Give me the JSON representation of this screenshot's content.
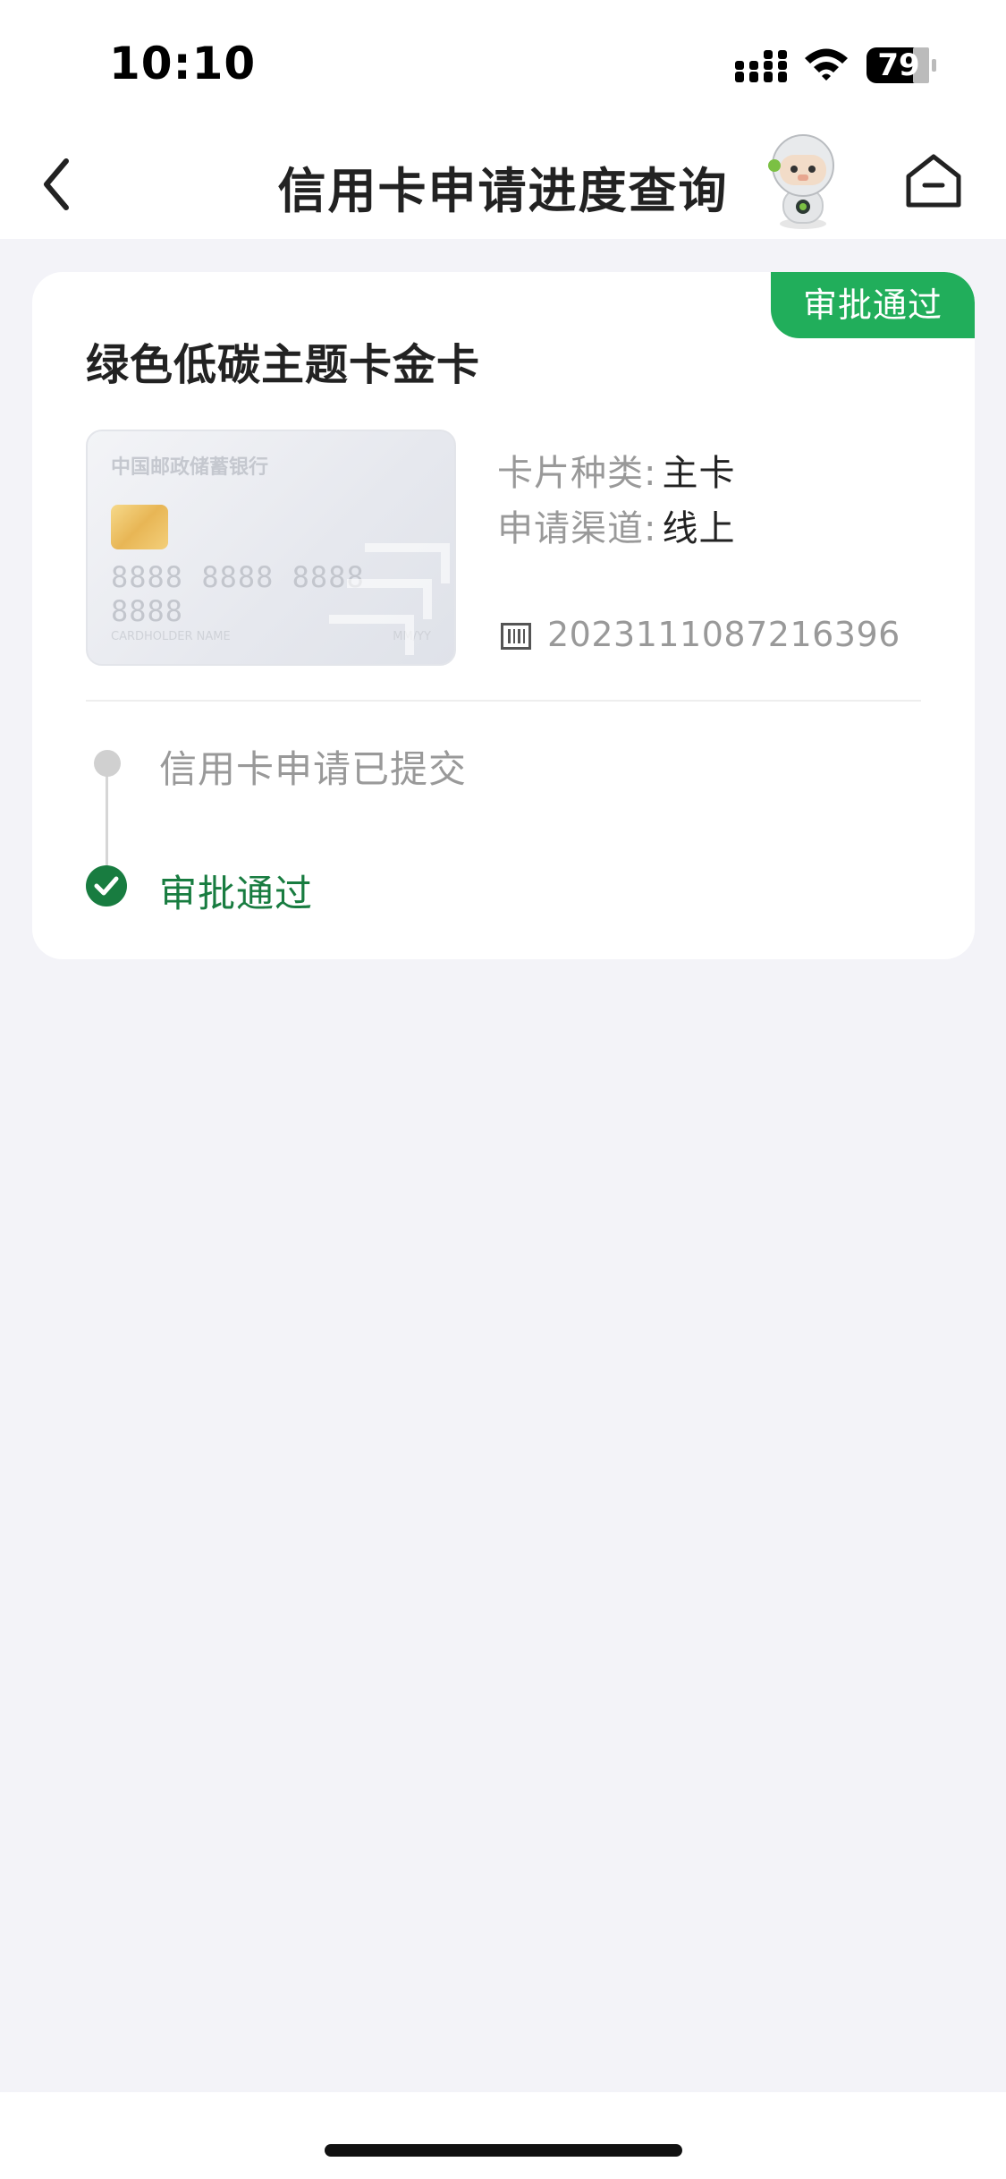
{
  "status_bar": {
    "time": "10:10",
    "battery": "79",
    "icons": [
      "signal-icon",
      "wifi-icon",
      "battery-icon"
    ]
  },
  "nav": {
    "title": "信用卡申请进度查询",
    "icons": [
      "back-icon",
      "robot-assistant-icon",
      "home-icon"
    ]
  },
  "application": {
    "status_badge": "审批通过",
    "card_name": "绿色低碳主题卡金卡",
    "card_image": {
      "bank_name": "中国邮政储蓄银行",
      "number": "8888 8888 8888 8888",
      "holder": "CARDHOLDER NAME",
      "expiry": "MM/YY"
    },
    "card_type_label": "卡片种类:",
    "card_type_value": "主卡",
    "channel_label": "申请渠道:",
    "channel_value": "线上",
    "application_number": "2023111087216396"
  },
  "timeline": [
    {
      "label": "信用卡申请已提交",
      "state": "done-grey"
    },
    {
      "label": "审批通过",
      "state": "current-green"
    }
  ],
  "colors": {
    "accent_green": "#21ae5b",
    "dark_green": "#187c40",
    "background": "#f3f3f8"
  }
}
